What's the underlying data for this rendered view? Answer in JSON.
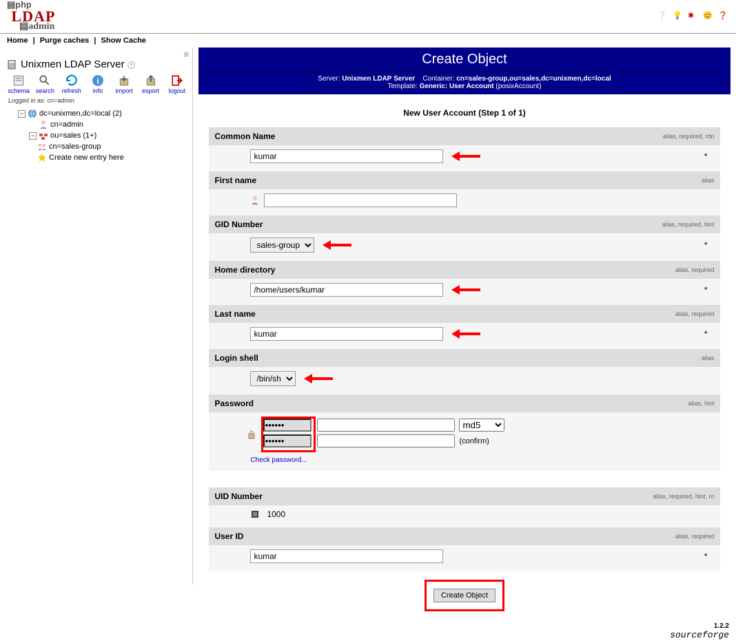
{
  "nav": {
    "home": "Home",
    "purge": "Purge caches",
    "show": "Show Cache"
  },
  "side": {
    "server": "Unixmen LDAP Server",
    "tools": {
      "schema": "schema",
      "search": "search",
      "refresh": "refresh",
      "info": "info",
      "import": "import",
      "export": "export",
      "logout": "logout"
    },
    "logged": "Logged in as: cn=admin"
  },
  "tree": {
    "root": "dc=unixmen,dc=local (2)",
    "admin": "cn=admin",
    "sales": "ou=sales (1+)",
    "group": "cn=sales-group",
    "new": "Create new entry here"
  },
  "header": {
    "title": "Create Object",
    "serverLabel": "Server:",
    "server": "Unixmen LDAP Server",
    "containerLabel": "Container:",
    "container": "cn=sales-group,ou=sales,dc=unixmen,dc=local",
    "templateLabel": "Template:",
    "template": "Generic: User Account",
    "templateType": "posixAccount"
  },
  "step": "New User Account (Step 1 of 1)",
  "fields": {
    "cn": {
      "label": "Common Name",
      "meta": "alias, required, rdn",
      "value": "kumar"
    },
    "fn": {
      "label": "First name",
      "meta": "alias",
      "value": ""
    },
    "gid": {
      "label": "GID Number",
      "meta": "alias, required, hint",
      "value": "sales-group"
    },
    "home": {
      "label": "Home directory",
      "meta": "alias, required",
      "value": "/home/users/kumar"
    },
    "ln": {
      "label": "Last name",
      "meta": "alias, required",
      "value": "kumar"
    },
    "shell": {
      "label": "Login shell",
      "meta": "alias",
      "value": "/bin/sh"
    },
    "pwd": {
      "label": "Password",
      "meta": "alias, hint",
      "check": "Check password...",
      "hash": "md5",
      "confirm": "(confirm)"
    },
    "uid": {
      "label": "UID Number",
      "meta": "alias, required, hint, ro",
      "value": "1000"
    },
    "userid": {
      "label": "User ID",
      "meta": "alias, required",
      "value": "kumar"
    }
  },
  "button": "Create Object",
  "footer": {
    "ver": "1.2.2",
    "sf": "sourceforge"
  }
}
